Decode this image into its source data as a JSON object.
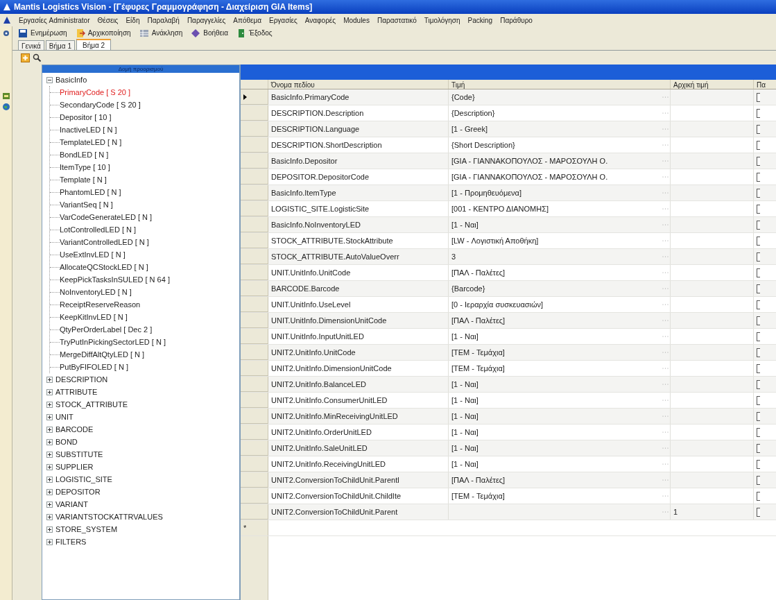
{
  "window": {
    "title": "Mantis Logistics Vision - [Γέφυρες Γραμμογράφηση - Διαχείριση GIA Items]"
  },
  "menu": [
    "Εργασίες Administrator",
    "Θέσεις",
    "Είδη",
    "Παραλαβή",
    "Παραγγελίες",
    "Απόθεμα",
    "Εργασίες",
    "Αναφορές",
    "Modules",
    "Παραστατικό",
    "Τιμολόγηση",
    "Packing",
    "Παράθυρο"
  ],
  "toolbar": [
    {
      "kind": "update",
      "label": "Ενημέρωση"
    },
    {
      "kind": "reset",
      "label": "Αρχικοποίηση"
    },
    {
      "kind": "recall",
      "label": "Ανάκληση"
    },
    {
      "kind": "help",
      "label": "Βοήθεια"
    },
    {
      "kind": "exit",
      "label": "Έξοδος"
    }
  ],
  "tabs": [
    {
      "label": "Γενικά",
      "selected": false
    },
    {
      "label": "Βήμα 1",
      "selected": false
    },
    {
      "label": "Βήμα 2",
      "selected": true
    }
  ],
  "tree": {
    "title": "Δομή προορισμού",
    "items": [
      {
        "label": "BasicInfo",
        "expanded": true,
        "children": [
          {
            "label": "PrimaryCode [ S 20 ]",
            "selected": true
          },
          {
            "label": "SecondaryCode [ S 20 ]",
            "selected": false
          },
          {
            "label": "Depositor [ 10 ]",
            "selected": false
          },
          {
            "label": "InactiveLED [ N ]",
            "selected": false
          },
          {
            "label": "TemplateLED [ N ]",
            "selected": false
          },
          {
            "label": "BondLED [ N ]",
            "selected": false
          },
          {
            "label": "ItemType [ 10 ]",
            "selected": false
          },
          {
            "label": "Template [ N ]",
            "selected": false
          },
          {
            "label": "PhantomLED [ N ]",
            "selected": false
          },
          {
            "label": "VariantSeq [ N ]",
            "selected": false
          },
          {
            "label": "VarCodeGenerateLED [ N ]",
            "selected": false
          },
          {
            "label": "LotControlledLED [ N ]",
            "selected": false
          },
          {
            "label": "VariantControlledLED [ N ]",
            "selected": false
          },
          {
            "label": "UseExtInvLED [ N ]",
            "selected": false
          },
          {
            "label": "AllocateQCStockLED [ N ]",
            "selected": false
          },
          {
            "label": "KeepPickTasksInSULED [ N 64 ]",
            "selected": false
          },
          {
            "label": "NoInventoryLED [ N ]",
            "selected": false
          },
          {
            "label": "ReceiptReserveReason",
            "selected": false
          },
          {
            "label": "KeepKitInvLED [ N ]",
            "selected": false
          },
          {
            "label": "QtyPerOrderLabel [ Dec 2 ]",
            "selected": false
          },
          {
            "label": "TryPutInPickingSectorLED [ N ]",
            "selected": false
          },
          {
            "label": "MergeDiffAltQtyLED [ N ]",
            "selected": false
          },
          {
            "label": "PutByFIFOLED [ N ]",
            "selected": false
          }
        ]
      },
      {
        "label": "DESCRIPTION",
        "expanded": false
      },
      {
        "label": "ATTRIBUTE",
        "expanded": false
      },
      {
        "label": "STOCK_ATTRIBUTE",
        "expanded": false
      },
      {
        "label": "UNIT",
        "expanded": false
      },
      {
        "label": "BARCODE",
        "expanded": false
      },
      {
        "label": "BOND",
        "expanded": false
      },
      {
        "label": "SUBSTITUTE",
        "expanded": false
      },
      {
        "label": "SUPPLIER",
        "expanded": false
      },
      {
        "label": "LOGISTIC_SITE",
        "expanded": false
      },
      {
        "label": "DEPOSITOR",
        "expanded": false
      },
      {
        "label": "VARIANT",
        "expanded": false
      },
      {
        "label": "VARIANTSTOCKATTRVALUES",
        "expanded": false
      },
      {
        "label": "STORE_SYSTEM",
        "expanded": false
      },
      {
        "label": "FILTERS",
        "expanded": false
      }
    ]
  },
  "grid": {
    "columns": [
      "Όνομα πεδίου",
      "Τιμή",
      "Αρχική τιμή",
      "Πα"
    ],
    "new_row_marker": "*",
    "rows": [
      {
        "field": "BasicInfo.PrimaryCode",
        "value": "{Code}",
        "selected": true,
        "checked": false
      },
      {
        "field": "DESCRIPTION.Description",
        "value": "{Description}",
        "selected": false,
        "checked": false
      },
      {
        "field": "DESCRIPTION.Language",
        "value": "[1 - Greek]",
        "selected": false,
        "checked": false
      },
      {
        "field": "DESCRIPTION.ShortDescription",
        "value": "{Short Description}",
        "selected": false,
        "checked": false
      },
      {
        "field": "BasicInfo.Depositor",
        "value": "[GIA - ΓΙΑΝΝΑΚΟΠΟΥΛΟΣ - ΜΑΡΟΣΟΥΛΗ Ο.",
        "selected": false,
        "checked": false
      },
      {
        "field": "DEPOSITOR.DepositorCode",
        "value": "[GIA - ΓΙΑΝΝΑΚΟΠΟΥΛΟΣ - ΜΑΡΟΣΟΥΛΗ Ο.",
        "selected": false,
        "checked": false
      },
      {
        "field": "BasicInfo.ItemType",
        "value": "[1 - Προμηθευόμενα]",
        "selected": false,
        "checked": false
      },
      {
        "field": "LOGISTIC_SITE.LogisticSite",
        "value": "[001 - ΚΕΝΤΡΟ ΔΙΑΝΟΜΗΣ]",
        "selected": false,
        "checked": false
      },
      {
        "field": "BasicInfo.NoInventoryLED",
        "value": "[1 - Ναι]",
        "selected": false,
        "checked": false
      },
      {
        "field": "STOCK_ATTRIBUTE.StockAttribute",
        "value": "[LW - Λογιστική Αποθήκη]",
        "selected": false,
        "checked": false
      },
      {
        "field": "STOCK_ATTRIBUTE.AutoValueOverr",
        "value": "3",
        "selected": false,
        "checked": false
      },
      {
        "field": "UNIT.UnitInfo.UnitCode",
        "value": "[ΠΑΛ - Παλέτες]",
        "selected": false,
        "checked": false
      },
      {
        "field": "BARCODE.Barcode",
        "value": "{Barcode}",
        "selected": false,
        "checked": false
      },
      {
        "field": "UNIT.UnitInfo.UseLevel",
        "value": "[0 - Ιεραρχία συσκευασιών]",
        "selected": false,
        "checked": false
      },
      {
        "field": "UNIT.UnitInfo.DimensionUnitCode",
        "value": "[ΠΑΛ - Παλέτες]",
        "selected": false,
        "checked": false
      },
      {
        "field": "UNIT.UnitInfo.InputUnitLED",
        "value": "[1 - Ναι]",
        "selected": false,
        "checked": false
      },
      {
        "field": "UNIT2.UnitInfo.UnitCode",
        "value": "[TEM - Τεμάχια]",
        "selected": false,
        "checked": false
      },
      {
        "field": "UNIT2.UnitInfo.DimensionUnitCode",
        "value": "[TEM - Τεμάχια]",
        "selected": false,
        "checked": false
      },
      {
        "field": "UNIT2.UnitInfo.BalanceLED",
        "value": "[1 - Ναι]",
        "selected": false,
        "checked": false
      },
      {
        "field": "UNIT2.UnitInfo.ConsumerUnitLED",
        "value": "[1 - Ναι]",
        "selected": false,
        "checked": false
      },
      {
        "field": "UNIT2.UnitInfo.MinReceivingUnitLED",
        "value": "[1 - Ναι]",
        "selected": false,
        "checked": false
      },
      {
        "field": "UNIT2.UnitInfo.OrderUnitLED",
        "value": "[1 - Ναι]",
        "selected": false,
        "checked": false
      },
      {
        "field": "UNIT2.UnitInfo.SaleUnitLED",
        "value": "[1 - Ναι]",
        "selected": false,
        "checked": false
      },
      {
        "field": "UNIT2.UnitInfo.ReceivingUnitLED",
        "value": "[1 - Ναι]",
        "selected": false,
        "checked": false
      },
      {
        "field": "UNIT2.ConversionToChildUnit.Parentl",
        "value": "[ΠΑΛ - Παλέτες]",
        "selected": false,
        "checked": false
      },
      {
        "field": "UNIT2.ConversionToChildUnit.ChildIte",
        "value": "[TEM - Τεμάχια]",
        "selected": false,
        "checked": false
      },
      {
        "field": "UNIT2.ConversionToChildUnit.Parent",
        "initial": "1",
        "selected": false,
        "checked": false
      }
    ]
  }
}
